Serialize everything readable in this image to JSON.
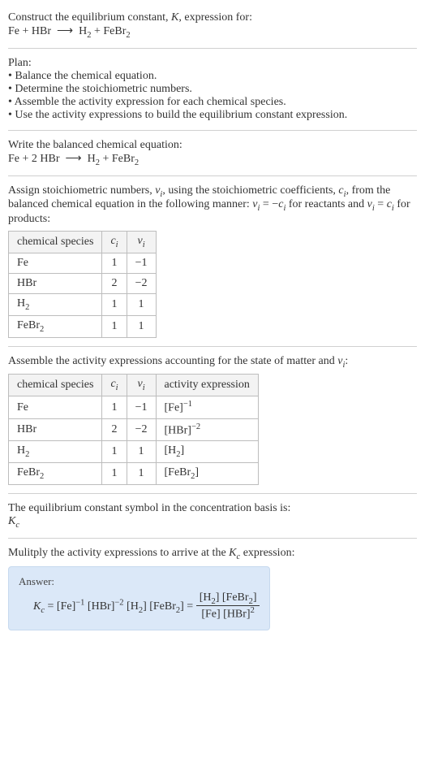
{
  "intro": {
    "line1": "Construct the equilibrium constant, ",
    "kSym": "K",
    "line1b": ", expression for:",
    "equation_lhs": "Fe + HBr",
    "arrow": "⟶",
    "equation_rhs_a": "H",
    "equation_rhs_b": " + FeBr"
  },
  "plan": {
    "title": "Plan:",
    "items": [
      "Balance the chemical equation.",
      "Determine the stoichiometric numbers.",
      "Assemble the activity expression for each chemical species.",
      "Use the activity expressions to build the equilibrium constant expression."
    ]
  },
  "balanced": {
    "title": "Write the balanced chemical equation:",
    "lhs": "Fe + 2 HBr",
    "arrow": "⟶",
    "rhs_a": "H",
    "rhs_b": " + FeBr"
  },
  "stoich": {
    "intro_a": "Assign stoichiometric numbers, ",
    "nu": "ν",
    "sub_i": "i",
    "intro_b": ", using the stoichiometric coefficients, ",
    "c": "c",
    "intro_c": ", from the balanced chemical equation in the following manner: ",
    "rel_react": " = −",
    "intro_d": " for reactants and ",
    "rel_prod": " = ",
    "intro_e": " for products:",
    "headers": [
      "chemical species"
    ],
    "h_c": "c",
    "h_nu": "ν",
    "rows": [
      {
        "sp": "Fe",
        "c": "1",
        "nu": "−1"
      },
      {
        "sp": "HBr",
        "c": "2",
        "nu": "−2"
      },
      {
        "sp": "H",
        "sub": "2",
        "c": "1",
        "nu": "1"
      },
      {
        "sp": "FeBr",
        "sub": "2",
        "c": "1",
        "nu": "1"
      }
    ]
  },
  "activity": {
    "intro_a": "Assemble the activity expressions accounting for the state of matter and ",
    "nu": "ν",
    "sub_i": "i",
    "intro_b": ":",
    "h_sp": "chemical species",
    "h_c": "c",
    "h_nu": "ν",
    "h_act": "activity expression",
    "rows": [
      {
        "sp": "Fe",
        "c": "1",
        "nu": "−1",
        "act_base": "[Fe]",
        "act_exp": "−1"
      },
      {
        "sp": "HBr",
        "c": "2",
        "nu": "−2",
        "act_base": "[HBr]",
        "act_exp": "−2"
      },
      {
        "sp": "H",
        "sub": "2",
        "c": "1",
        "nu": "1",
        "act_base_a": "[H",
        "act_sub": "2",
        "act_base_b": "]"
      },
      {
        "sp": "FeBr",
        "sub": "2",
        "c": "1",
        "nu": "1",
        "act_base_a": "[FeBr",
        "act_sub": "2",
        "act_base_b": "]"
      }
    ]
  },
  "symbol": {
    "line": "The equilibrium constant symbol in the concentration basis is:",
    "K": "K",
    "sub": "c"
  },
  "multiply": {
    "line_a": "Mulitply the activity expressions to arrive at the ",
    "K": "K",
    "sub": "c",
    "line_b": " expression:"
  },
  "answer": {
    "label": "Answer:",
    "K": "K",
    "sub": "c",
    "eq": " = [Fe]",
    "exp1": "−1",
    "part2": " [HBr]",
    "exp2": "−2",
    "part3": " [H",
    "sub2a": "2",
    "part4": "] [FeBr",
    "sub2b": "2",
    "part5": "] = ",
    "num_a": "[H",
    "num_sub1": "2",
    "num_b": "] [FeBr",
    "num_sub2": "2",
    "num_c": "]",
    "den_a": "[Fe] [HBr]",
    "den_exp": "2"
  }
}
